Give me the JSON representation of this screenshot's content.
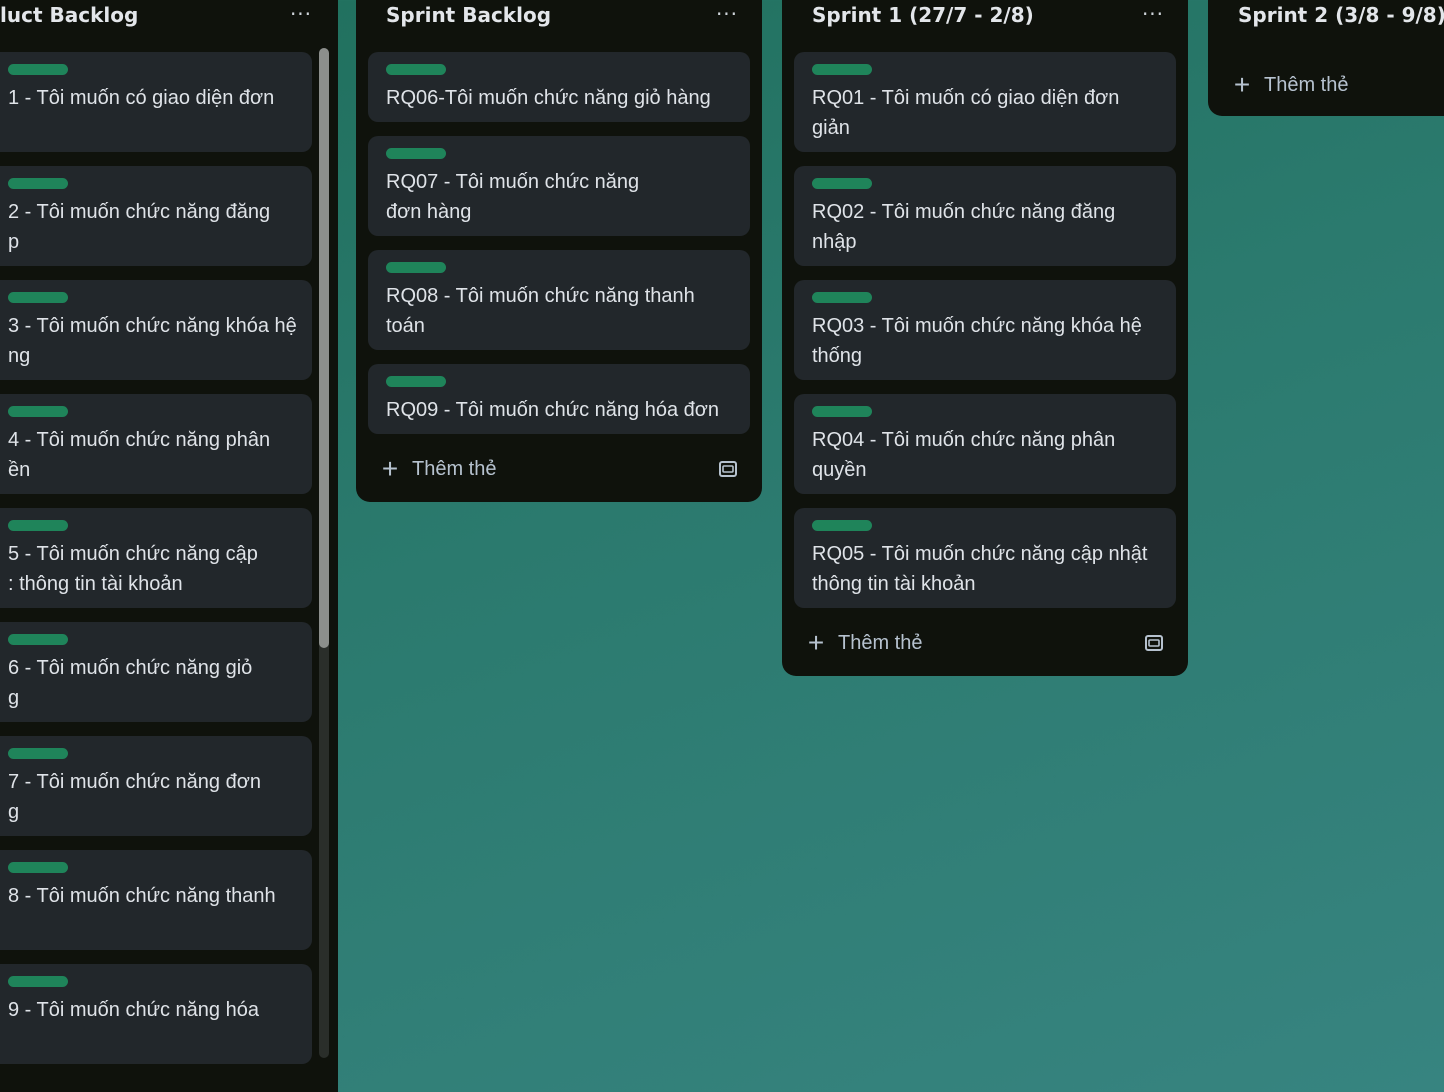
{
  "lists": [
    {
      "title": "luct Backlog",
      "cards": [
        "1 - Tôi muốn có giao diện đơn",
        "2 - Tôi muốn chức năng đăng\np",
        "3 - Tôi muốn chức năng khóa hệ\nng",
        "4 - Tôi muốn chức năng phân\nền",
        "5 - Tôi muốn chức năng cập\n: thông tin tài khoản",
        "6 - Tôi muốn chức năng giỏ\ng",
        "7 - Tôi muốn chức năng đơn\ng",
        "8 - Tôi muốn chức năng thanh",
        "9 - Tôi muốn chức năng hóa"
      ]
    },
    {
      "title": "Sprint Backlog",
      "cards": [
        "RQ06-Tôi muốn chức năng giỏ hàng",
        "RQ07 - Tôi muốn chức năng đơn hàng",
        "RQ08 - Tôi muốn chức năng thanh toán",
        "RQ09 - Tôi muốn chức năng hóa đơn"
      ],
      "add_label": "Thêm thẻ"
    },
    {
      "title": "Sprint 1 (27/7 - 2/8)",
      "cards": [
        "RQ01 - Tôi muốn có giao diện đơn giản",
        "RQ02 - Tôi muốn chức năng đăng nhập",
        "RQ03 - Tôi muốn chức năng khóa hệ thống",
        "RQ04 - Tôi muốn chức năng phân quyền",
        "RQ05 - Tôi muốn chức năng cập nhật thông tin tài khoản"
      ],
      "add_label": "Thêm thẻ"
    },
    {
      "title": "Sprint 2 (3/8 - 9/8)",
      "add_label": "Thêm thẻ"
    }
  ],
  "icons": {
    "list_menu": "ellipsis-icon",
    "add": "plus-icon",
    "template": "card-template-icon"
  },
  "colors": {
    "board_bg_start": "#1f6f5c",
    "board_bg_end": "#378480",
    "list_bg": "#0f120c",
    "card_bg": "#22272b",
    "label_green": "#1f845a"
  },
  "menu_glyph": "···"
}
